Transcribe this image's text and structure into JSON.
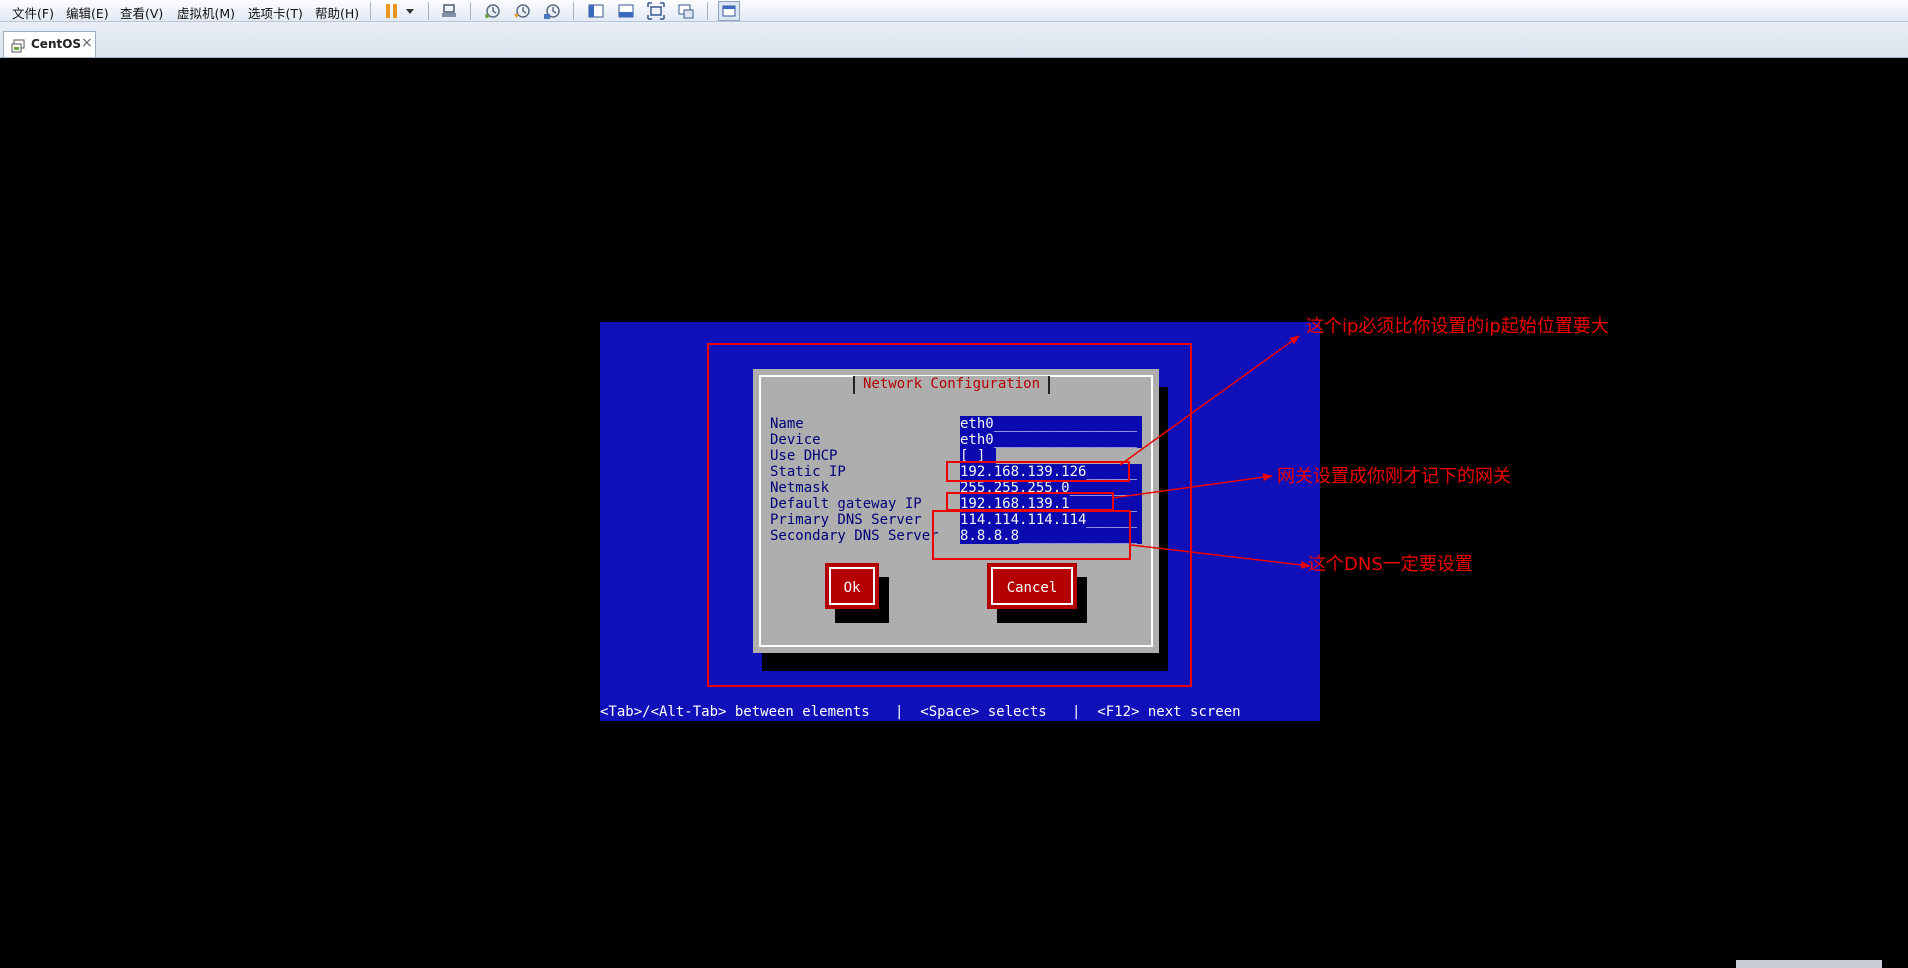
{
  "menu": {
    "items": [
      "文件(F)",
      "编辑(E)",
      "查看(V)",
      "虚拟机(M)",
      "选项卡(T)",
      "帮助(H)"
    ]
  },
  "toolbar": {
    "icons": [
      "pause-icon",
      "dropdown-arrow-icon",
      "send-ctrl-alt-del-icon",
      "snapshot-icon",
      "revert-snapshot-icon",
      "snapshot-manager-icon",
      "sidebar-icon",
      "thumbnail-icon",
      "fullscreen-icon",
      "unity-icon",
      "console-view-icon"
    ]
  },
  "tab": {
    "label": "CentOS",
    "close": "×"
  },
  "dialog": {
    "title": "Network Configuration",
    "fields": [
      {
        "label": "Name",
        "value": "eth0_________________"
      },
      {
        "label": "Device",
        "value": "eth0_________________"
      },
      {
        "label": "Use DHCP",
        "value": "[ ]"
      },
      {
        "label": "Static IP",
        "value": "192.168.139.126______"
      },
      {
        "label": "Netmask",
        "value": "255.255.255.0________"
      },
      {
        "label": "Default gateway IP",
        "value": "192.168.139.1________"
      },
      {
        "label": "Primary DNS Server",
        "value": "114.114.114.114______"
      },
      {
        "label": "Secondary DNS Server",
        "value": "8.8.8.8______________"
      }
    ],
    "ok_label": "Ok",
    "cancel_label": "Cancel"
  },
  "status_line": "<Tab>/<Alt-Tab> between elements   |  <Space> selects   |  <F12> next screen",
  "annotations": {
    "ip_note": "这个ip必须比你设置的ip起始位置要大",
    "gateway_note": "网关设置成你刚才记下的网关",
    "dns_note": "这个DNS一定要设置"
  },
  "colors": {
    "console_blue": "#1010b8",
    "dialog_gray": "#aeaeae",
    "button_red": "#b40000",
    "annotation_red": "#ee0000"
  }
}
